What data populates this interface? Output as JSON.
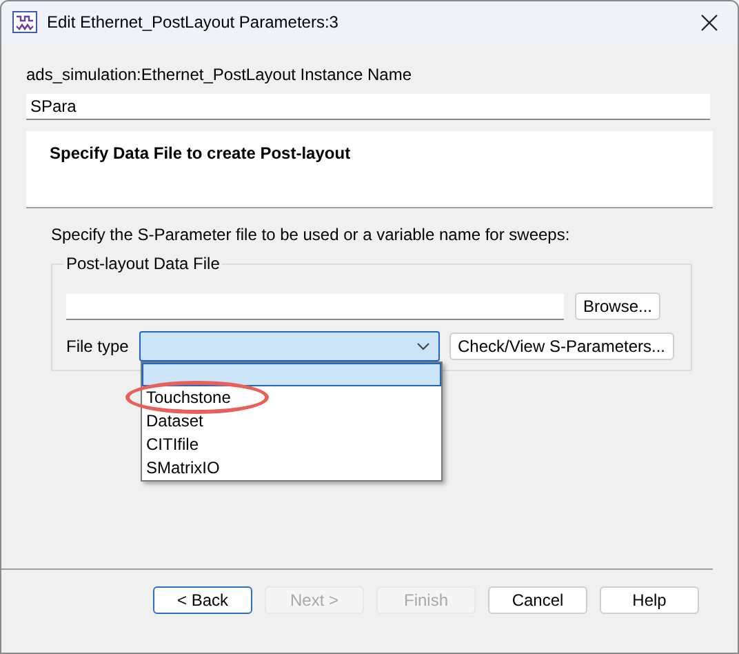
{
  "window": {
    "title": "Edit Ethernet_PostLayout Parameters:3"
  },
  "instance": {
    "label": "ads_simulation:Ethernet_PostLayout Instance Name",
    "value": "SPara"
  },
  "banner": {
    "title": "Specify Data File to create Post-layout"
  },
  "description": "Specify the S-Parameter file to be used or a variable name for sweeps:",
  "group": {
    "title": "Post-layout Data File",
    "browse_button": "Browse...",
    "file_type_label": "File type",
    "check_button": "Check/View S-Parameters...",
    "dropdown": {
      "expanded": true,
      "options": [
        {
          "selected": true,
          "circled": false
        },
        {
          "label": "Touchstone",
          "selected": false,
          "circled": true
        },
        {
          "label": "Dataset",
          "selected": false,
          "circled": false
        },
        {
          "label": "CITIfile",
          "selected": false,
          "circled": false
        },
        {
          "label": "SMatrixIO",
          "selected": false,
          "circled": false
        }
      ]
    }
  },
  "buttons": [
    {
      "label": "< Back",
      "disabled": false,
      "default": true
    },
    {
      "label": "Next >",
      "disabled": true,
      "default": false
    },
    {
      "label": "Finish",
      "disabled": true,
      "default": false
    },
    {
      "label": "Cancel",
      "disabled": false,
      "default": false
    },
    {
      "label": "Help",
      "disabled": false,
      "default": false
    }
  ]
}
